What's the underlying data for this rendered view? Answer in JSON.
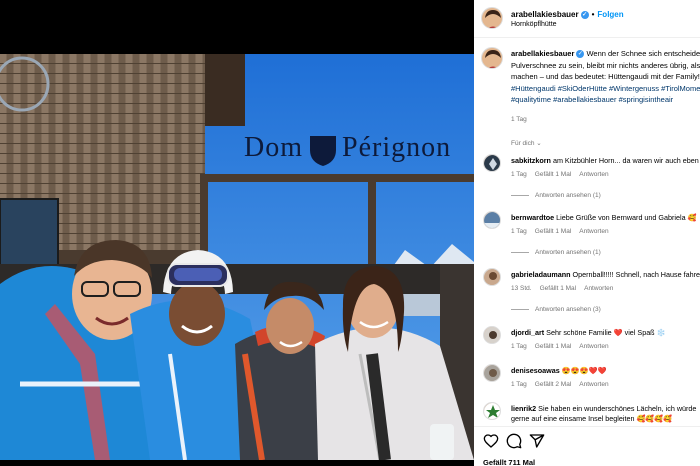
{
  "header": {
    "username": "arabellakiesbauer",
    "follow_label": "Folgen",
    "location": "Hornköpflhütte"
  },
  "photo": {
    "sign_text_left": "Dom",
    "sign_text_right": "Pérignon"
  },
  "caption": {
    "username": "arabellakiesbauer",
    "text": "Wenn der Schnee sich entscheidet, lieber Matsch als Pulverschnee zu sein, bleibt mir nichts anderes übrig, als das Beste draus zu machen – und das bedeutet: Hüttengaudi mit der Family! 😉",
    "hashtags": "#Hüttengaudi #SkiOderHütte #Wintergenuss #TirolMoments #familytime #qualitytime #arabellakiesbauer #springisintheair",
    "time": "1 Tag"
  },
  "translate_label": "Für dich",
  "comments": [
    {
      "user": "sabkitzkorn",
      "text": "am Kitzbühler Horn... da waren wir auch eben",
      "time": "1 Tag",
      "likes": "Gefällt 1 Mal",
      "reply": "Antworten",
      "replies": "Antworten ansehen (1)"
    },
    {
      "user": "bernwardtoe",
      "text": "Liebe Grüße von Bernward und Gabriela 🥰",
      "time": "1 Tag",
      "likes": "Gefällt 1 Mal",
      "reply": "Antworten",
      "replies": "Antworten ansehen (1)"
    },
    {
      "user": "gabrieladaumann",
      "text": "Opernball!!!!! Schnell, nach Hause fahren 😅",
      "time": "13 Std.",
      "likes": "Gefällt 1 Mal",
      "reply": "Antworten",
      "replies": "Antworten ansehen (3)"
    },
    {
      "user": "djordi_art",
      "text": "Sehr schöne Familie ❤️ viel Spaß ❄️",
      "time": "1 Tag",
      "likes": "Gefällt 1 Mal",
      "reply": "Antworten",
      "replies": ""
    },
    {
      "user": "denisesoawas",
      "text": "😍😍😍❤️❤️",
      "time": "1 Tag",
      "likes": "Gefällt 2 Mal",
      "reply": "Antworten",
      "replies": ""
    },
    {
      "user": "lienrik2",
      "text": "Sie haben ein wunderschönes Lächeln, ich würde",
      "text2": "gerne auf eine einsame Insel begleiten 🥰🥰🥰🥰",
      "time": "",
      "likes": "",
      "reply": "",
      "replies": ""
    }
  ],
  "likes_count": "Gefällt 711 Mal",
  "colors": {
    "accent": "#0095f6",
    "verified": "#3897f0",
    "hashtag": "#00376b"
  },
  "icons": [
    "heart-icon",
    "comment-icon",
    "share-icon"
  ]
}
